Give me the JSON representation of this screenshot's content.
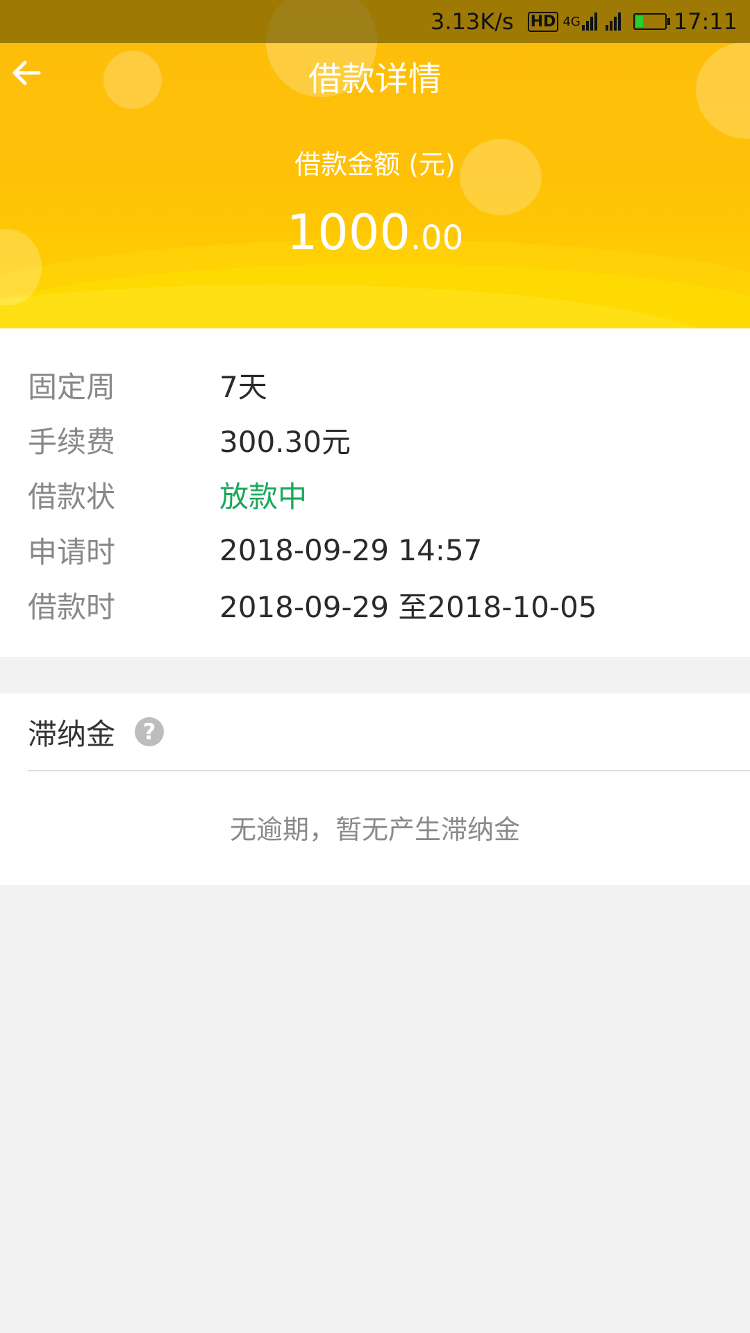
{
  "status_bar": {
    "net_speed": "3.13K/s",
    "hd": "HD",
    "network": "4G",
    "time": "17:11",
    "battery_color": "#2ecc2e"
  },
  "header": {
    "title": "借款详情",
    "amount_label": "借款金额 (元)",
    "amount_integer": "1000",
    "amount_decimal": ".00",
    "back_icon": "arrow-left-icon"
  },
  "details": [
    {
      "label": "固定周",
      "value": "7天"
    },
    {
      "label": "手续费",
      "value": "300.30元"
    },
    {
      "label": "借款状",
      "value": "放款中",
      "color": "#1aa85a"
    },
    {
      "label": "申请时",
      "value": "2018-09-29 14:57"
    },
    {
      "label": "借款时",
      "value": "2018-09-29 至2018-10-05"
    }
  ],
  "late_fee": {
    "title": "滞纳金",
    "help_symbol": "?",
    "empty_text": "无逾期，暂无产生滞纳金"
  }
}
